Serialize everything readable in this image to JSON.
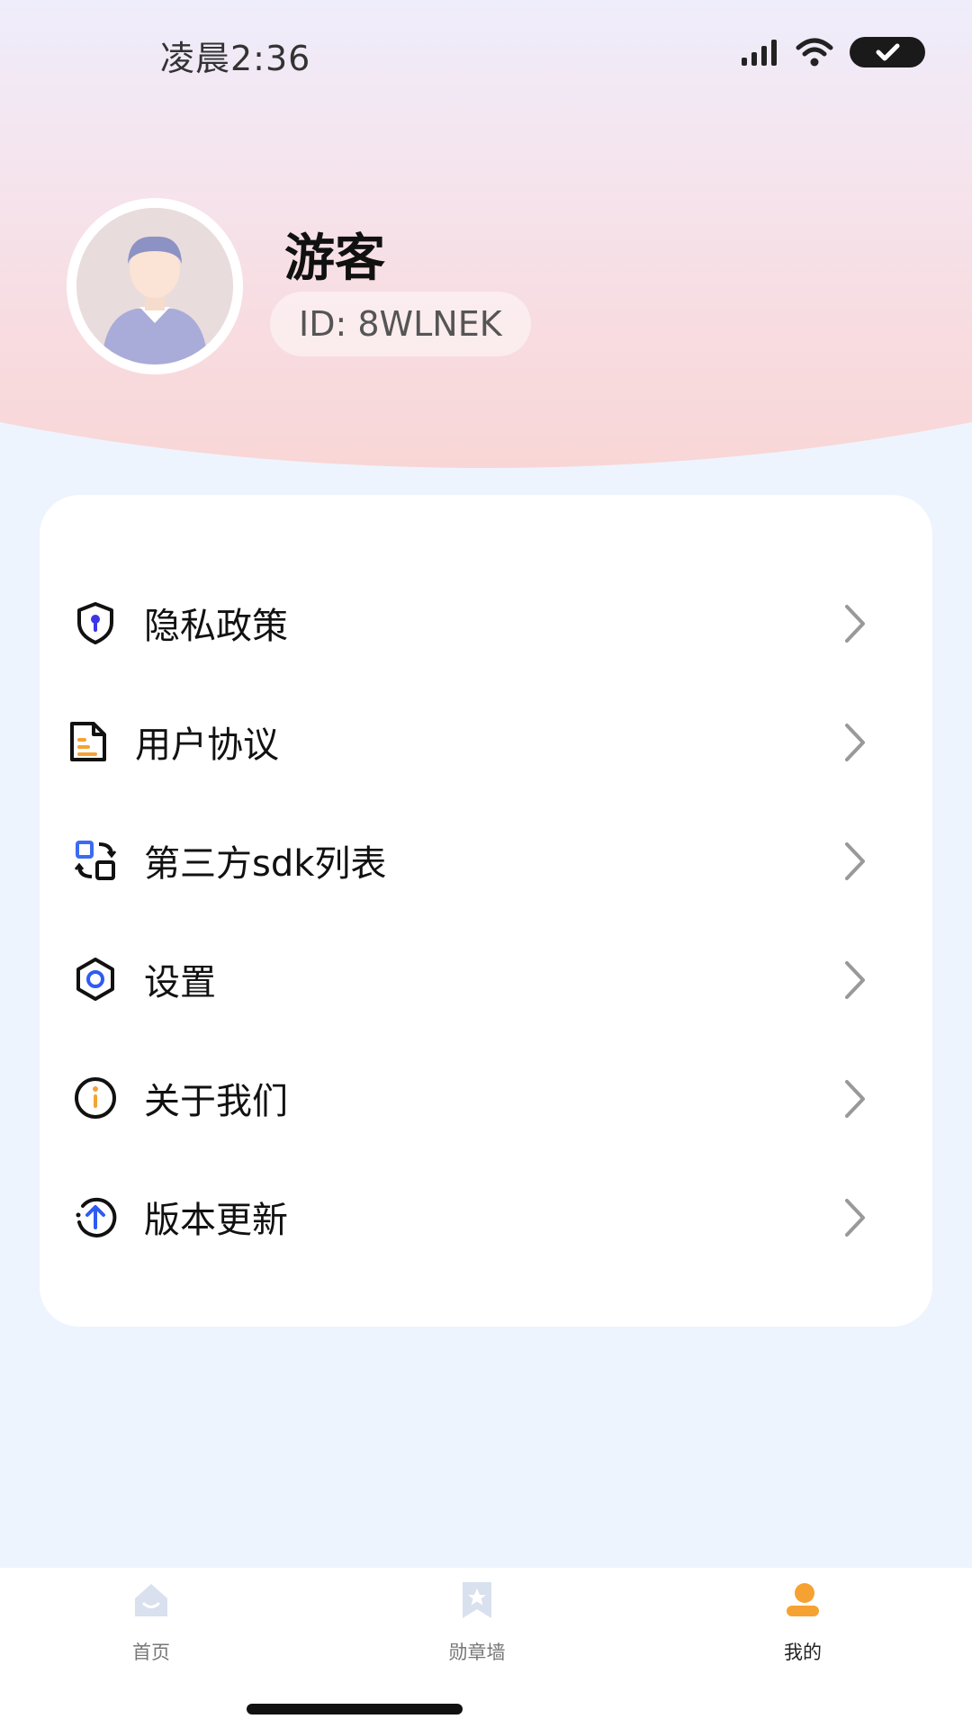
{
  "status_bar": {
    "time": "凌晨2:36"
  },
  "profile": {
    "name": "游客",
    "id_text": "ID: 8WLNEK"
  },
  "menu": {
    "items": [
      {
        "label": "隐私政策",
        "icon": "shield-icon"
      },
      {
        "label": "用户协议",
        "icon": "document-icon"
      },
      {
        "label": "第三方sdk列表",
        "icon": "sync-blocks-icon"
      },
      {
        "label": "设置",
        "icon": "hexagon-settings-icon"
      },
      {
        "label": "关于我们",
        "icon": "info-icon"
      },
      {
        "label": "版本更新",
        "icon": "upload-arrow-icon"
      }
    ]
  },
  "tabs": [
    {
      "label": "首页",
      "icon": "home-icon",
      "active": false
    },
    {
      "label": "勋章墙",
      "icon": "medal-icon",
      "active": false
    },
    {
      "label": "我的",
      "icon": "profile-icon",
      "active": true
    }
  ],
  "colors": {
    "accent_orange": "#f5a233",
    "accent_blue": "#2f5bf3",
    "inactive_icon": "#d9e0ee"
  }
}
